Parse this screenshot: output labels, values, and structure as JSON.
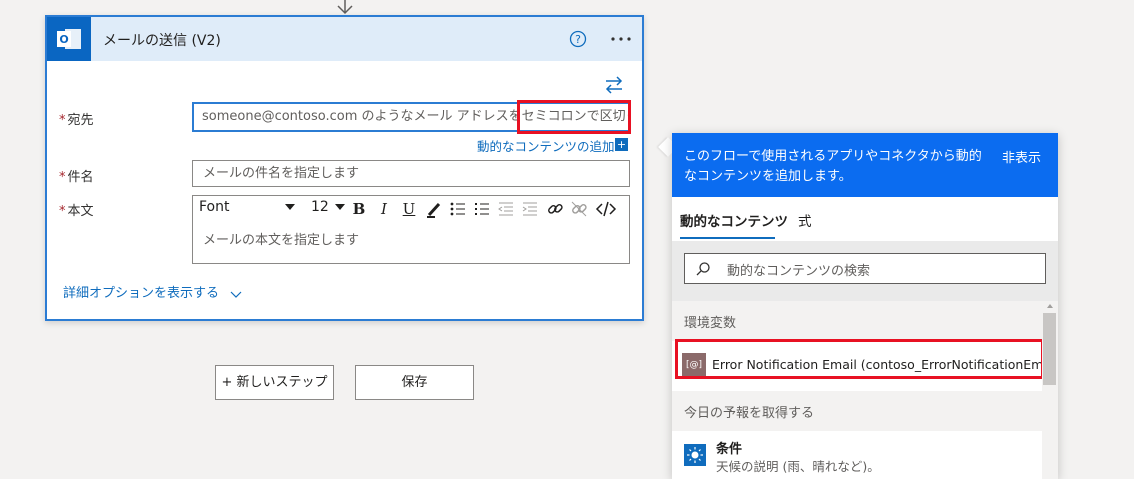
{
  "card": {
    "title": "メールの送信 (V2)",
    "fields": {
      "to": {
        "label": "宛先",
        "placeholder": "someone@contoso.com のようなメール アドレスをセミコロンで区切って指定"
      },
      "subject": {
        "label": "件名",
        "placeholder": "メールの件名を指定します"
      },
      "body": {
        "label": "本文",
        "placeholder": "メールの本文を指定します"
      }
    },
    "required_mark": "*",
    "add_dynamic_link": "動的なコンテンツの追加",
    "add_dynamic_plus": "+",
    "advanced_options": "詳細オプションを表示する",
    "toolbar": {
      "font": "Font",
      "size": "12"
    }
  },
  "buttons": {
    "new_step": "+ 新しいステップ",
    "save": "保存"
  },
  "flyout": {
    "description": "このフローで使用されるアプリやコネクタから動的なコンテンツを追加します。",
    "hide": "非表示",
    "tabs": [
      "動的なコンテンツ",
      "式"
    ],
    "search_placeholder": "動的なコンテンツの検索",
    "sections": [
      {
        "title": "環境変数",
        "items": [
          {
            "icon_text": "[@]",
            "label": "Error Notification Email (contoso_ErrorNotificationEmail)"
          }
        ]
      },
      {
        "title": "今日の予報を取得する",
        "items": [
          {
            "title": "条件",
            "description": "天候の説明 (雨、晴れなど)。"
          }
        ]
      }
    ]
  },
  "colors": {
    "accent": "#0f6cbd",
    "flyout_header": "#0b6cf0",
    "highlight": "#e81123"
  }
}
